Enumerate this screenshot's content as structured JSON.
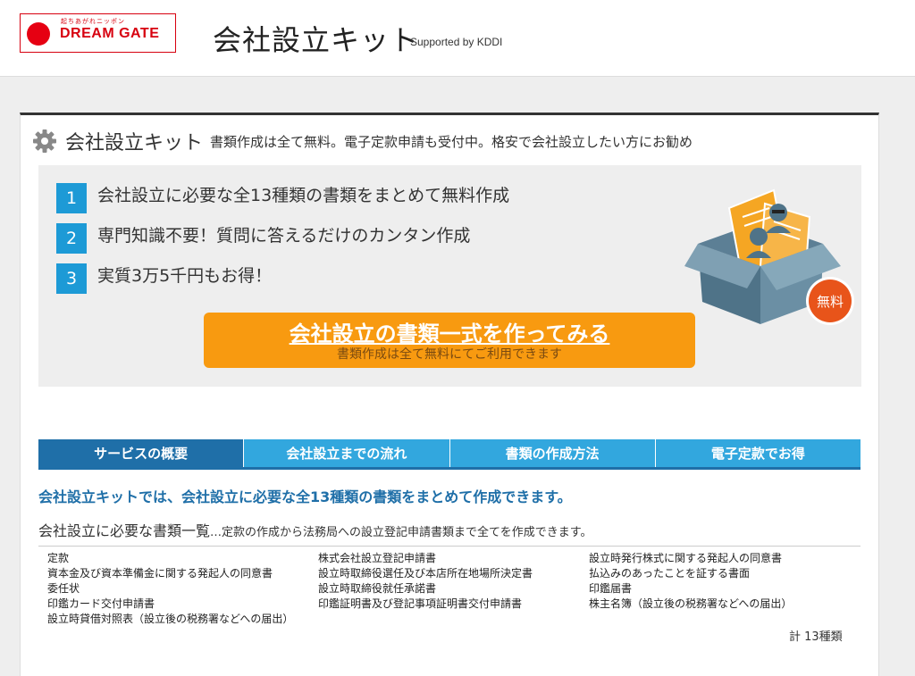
{
  "header": {
    "logo_tagline": "起ちあがれニッポン",
    "logo_name": "DREAM GATE",
    "site_title": "会社設立キット",
    "supported_by": "Supported by KDDI"
  },
  "panel": {
    "title": "会社設立キット",
    "description": "書類作成は全て無料。電子定款申請も受付中。格安で会社設立したい方にお勧め",
    "features": [
      {
        "num": "1",
        "text": "会社設立に必要な全13種類の書類をまとめて無料作成"
      },
      {
        "num": "2",
        "text": "専門知識不要！質問に答えるだけのカンタン作成"
      },
      {
        "num": "3",
        "text": "実質3万5千円もお得！"
      }
    ],
    "badge": "無料",
    "cta_label": "会社設立の書類一式を作ってみる",
    "cta_sub": "書類作成は全て無料にてご利用できます"
  },
  "tabs": [
    {
      "label": "サービスの概要"
    },
    {
      "label": "会社設立までの流れ"
    },
    {
      "label": "書類の作成方法"
    },
    {
      "label": "電子定款でお得"
    }
  ],
  "lead": "会社設立キットでは、会社設立に必要な全13種類の書類をまとめて作成できます。",
  "documents": {
    "heading": "会社設立に必要な書類一覧",
    "note": "…定款の作成から法務局への設立登記申請書類まで全てを作成できます。",
    "columns": [
      [
        "定款",
        "資本金及び資本準備金に関する発起人の同意書",
        "委任状",
        "印鑑カード交付申請書",
        "設立時貸借対照表（設立後の税務署などへの届出）"
      ],
      [
        "株式会社設立登記申請書",
        "設立時取締役選任及び本店所在地場所決定書",
        "設立時取締役就任承諾書",
        "印鑑証明書及び登記事項証明書交付申請書"
      ],
      [
        "設立時発行株式に関する発起人の同意書",
        "払込みのあったことを証する書面",
        "印鑑届書",
        "株主名簿（設立後の税務署などへの届出）"
      ]
    ],
    "total": "計 13種類"
  },
  "colors": {
    "brand_red": "#e60012",
    "tab_blue": "#32a7de",
    "tab_active": "#1f6fa8",
    "cta_orange": "#f89a10",
    "number_blue": "#1d9ad6"
  }
}
